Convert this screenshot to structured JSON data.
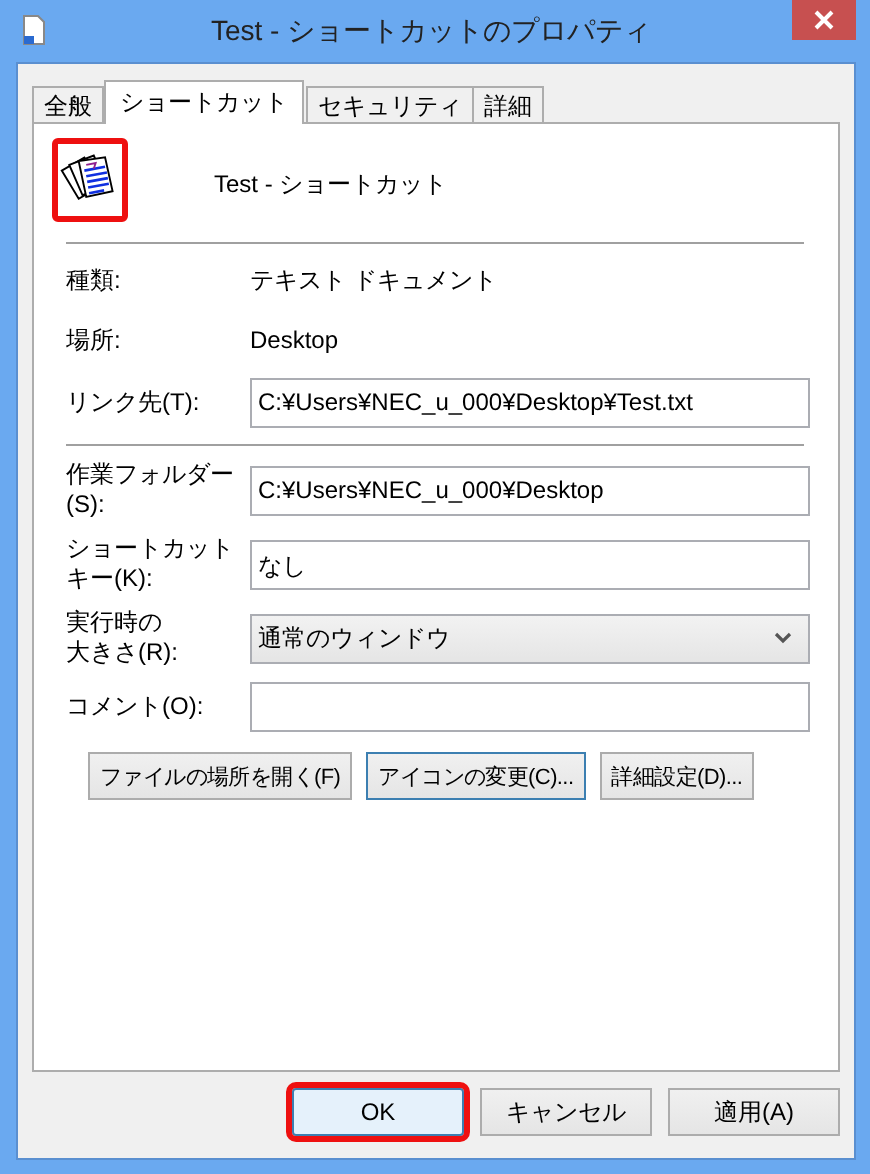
{
  "window": {
    "title": "Test - ショートカットのプロパティ"
  },
  "tabs": [
    {
      "label": "全般",
      "selected": false
    },
    {
      "label": "ショートカット",
      "selected": true
    },
    {
      "label": "セキュリティ",
      "selected": false
    },
    {
      "label": "詳細",
      "selected": false
    }
  ],
  "header": {
    "name": "Test - ショートカット",
    "icon_highlighted": true
  },
  "info": [
    {
      "label": "種類:",
      "value": "テキスト ドキュメント"
    },
    {
      "label": "場所:",
      "value": "Desktop"
    }
  ],
  "target": {
    "label": "リンク先(T):",
    "value": "C:¥Users¥NEC_u_000¥Desktop¥Test.txt"
  },
  "fields": [
    {
      "kind": "text",
      "label_lines": [
        "作業フォルダー",
        "(S):"
      ],
      "value": "C:¥Users¥NEC_u_000¥Desktop"
    },
    {
      "kind": "text",
      "label_lines": [
        "ショートカット",
        "キー(K):"
      ],
      "value": "なし"
    },
    {
      "kind": "select",
      "label_lines": [
        "実行時の",
        "大きさ(R):"
      ],
      "value": "通常のウィンドウ"
    },
    {
      "kind": "text",
      "label_lines": [
        "コメント(O):"
      ]
    }
  ],
  "action_buttons": [
    {
      "label": "ファイルの場所を開く(F)",
      "focused": false
    },
    {
      "label": "アイコンの変更(C)...",
      "focused": true
    },
    {
      "label": "詳細設定(D)...",
      "focused": false
    }
  ],
  "dialog_buttons": [
    {
      "label": "OK",
      "default": true,
      "highlighted": true
    },
    {
      "label": "キャンセル",
      "default": false,
      "highlighted": false
    },
    {
      "label": "適用(A)",
      "default": false,
      "highlighted": false
    }
  ]
}
